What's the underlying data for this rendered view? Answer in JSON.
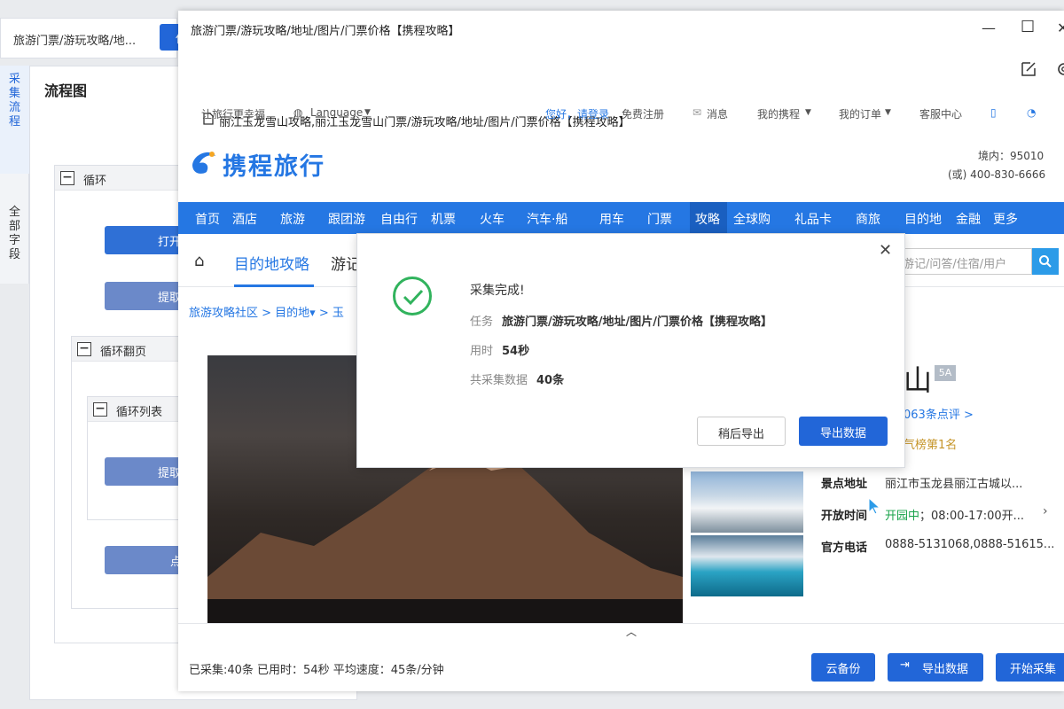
{
  "back_window": {
    "tab_title": "旅游门票/游玩攻略/地...",
    "tab_button": "保",
    "side_tabs": [
      "采集流程",
      "全部字段"
    ],
    "flow_title": "流程图",
    "loop1": "循环",
    "loop_page": "循环翻页",
    "loop_list": "循环列表",
    "btn_open": "打开网页",
    "btn_extract1": "提取数据",
    "btn_extract2": "提取数据",
    "btn_click": "点击翻页"
  },
  "window": {
    "title": "旅游门票/游玩攻略/地址/图片/门票价格【携程攻略】",
    "address": "丽江玉龙雪山攻略,丽江玉龙雪山门票/游玩攻略/地址/图片/门票价格【携程攻略】"
  },
  "site": {
    "slogan": "让旅行更幸福",
    "language": "Language",
    "greeting": "您好，请登录",
    "register": "免费注册",
    "messages": "消息",
    "my_ctrip": "我的携程",
    "my_orders": "我的订单",
    "service": "客服中心",
    "logo": "携程旅行",
    "hotline_domestic": "境内：95010",
    "hotline_other": "(或) 400-830-6666",
    "nav": [
      "首页",
      "酒店",
      "旅游",
      "跟团游",
      "自由行",
      "机票",
      "火车",
      "汽车·船",
      "用车",
      "门票",
      "攻略",
      "全球购",
      "礼品卡",
      "商旅",
      "目的地",
      "金融",
      "更多"
    ],
    "tab_active": "目的地攻略",
    "tab_other": "游记",
    "search_placeholder": "游记/问答/住宿/用户",
    "breadcrumb": "旅游攻略社区 > 目的地▾ > 玉",
    "rating_badge": "5A",
    "title_char": "山",
    "reviews": "063条点评 >",
    "rank": "气榜第1名",
    "address_label": "景点地址",
    "address_value": "丽江市玉龙县丽江古城以...",
    "hours_label": "开放时间",
    "hours_status": "开园中",
    "hours_value": "；08:00-17:00开...",
    "phone_label": "官方电话",
    "phone_value": "0888-5131068,0888-51615..."
  },
  "status": {
    "text": "已采集:40条 已用时：54秒 平均速度：45条/分钟",
    "cloud_backup": "云备份",
    "export": "导出数据",
    "start": "开始采集"
  },
  "modal": {
    "title": "采集完成!",
    "task_label": "任务",
    "task_value": "旅游门票/游玩攻略/地址/图片/门票价格【携程攻略】",
    "time_label": "用时",
    "time_value": "54秒",
    "count_label": "共采集数据",
    "count_value": "40条",
    "later": "稍后导出",
    "export": "导出数据"
  },
  "colors": {
    "accent": "#2266d8",
    "site_blue": "#2577e3",
    "success": "#31b35d"
  }
}
